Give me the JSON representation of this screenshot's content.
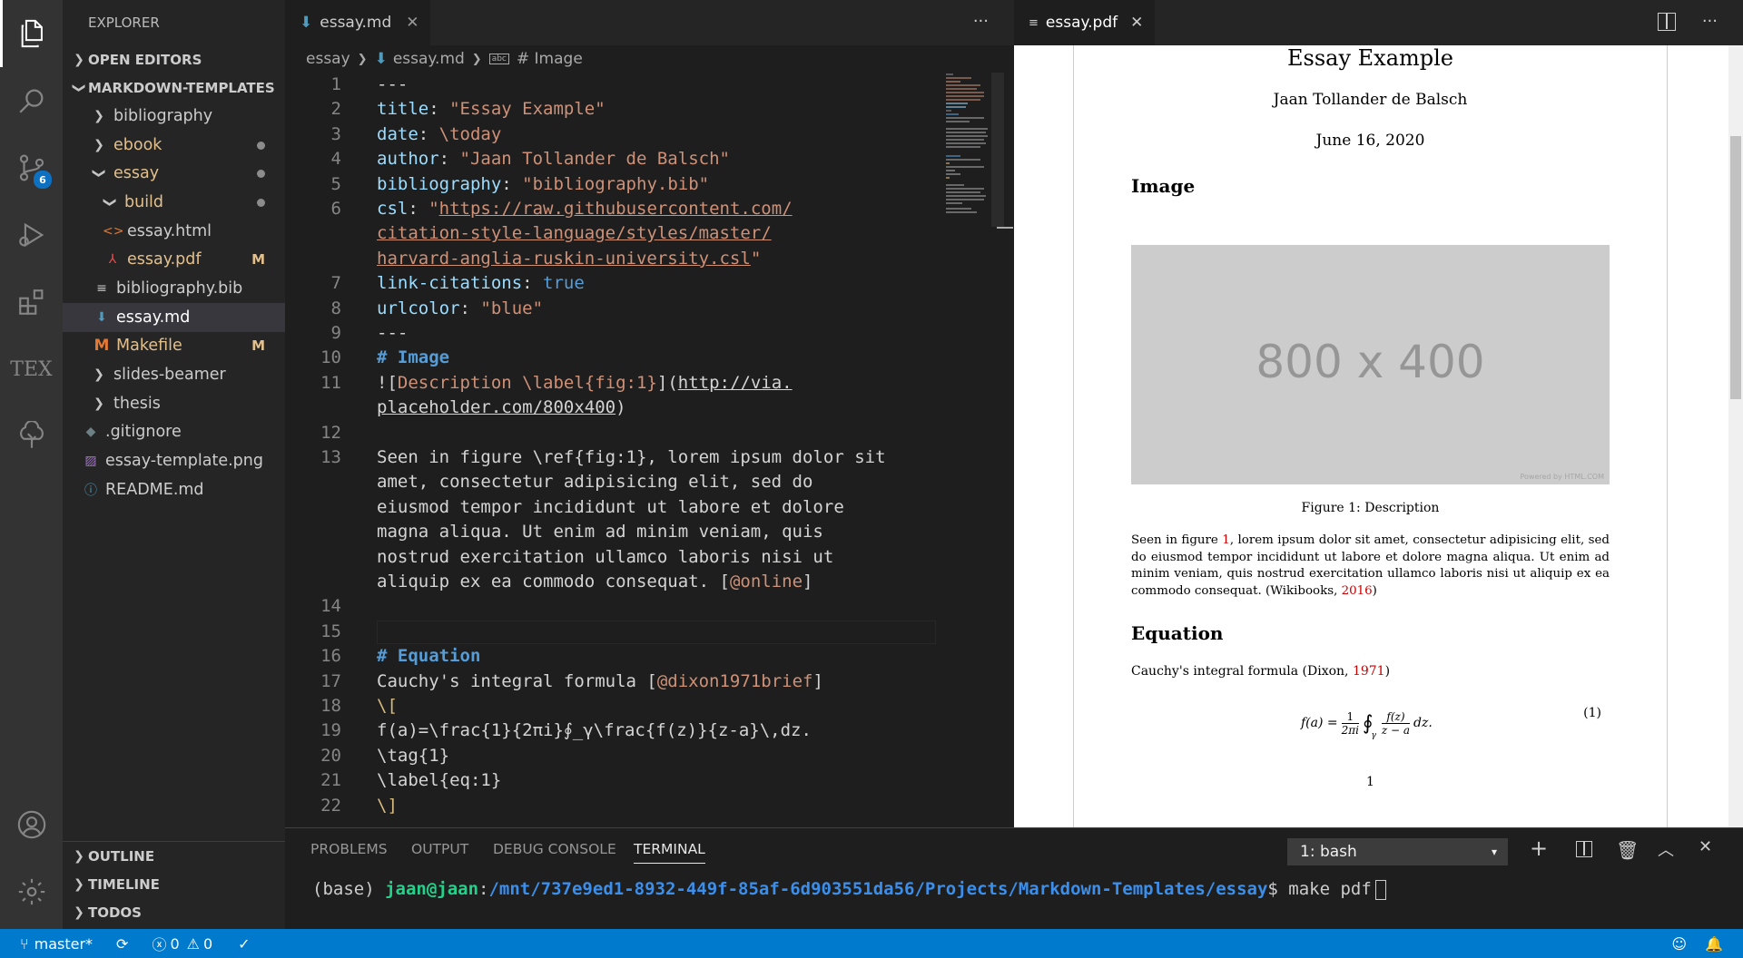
{
  "activity": {
    "scm_badge": "6",
    "tex_label": "TEX"
  },
  "sidebar": {
    "title": "EXPLORER",
    "open_editors": "OPEN EDITORS",
    "root": "MARKDOWN-TEMPLATES",
    "items": [
      {
        "label": "bibliography"
      },
      {
        "label": "ebook"
      },
      {
        "label": "essay"
      },
      {
        "label": "build"
      },
      {
        "label": "essay.html"
      },
      {
        "label": "essay.pdf",
        "status": "M"
      },
      {
        "label": "bibliography.bib"
      },
      {
        "label": "essay.md"
      },
      {
        "label": "Makefile",
        "status": "M"
      },
      {
        "label": "slides-beamer"
      },
      {
        "label": "thesis"
      },
      {
        "label": ".gitignore"
      },
      {
        "label": "essay-template.png"
      },
      {
        "label": "README.md"
      }
    ],
    "outline": "OUTLINE",
    "timeline": "TIMELINE",
    "todos": "TODOS"
  },
  "editor": {
    "tab_label": "essay.md",
    "more": "···",
    "breadcrumb": {
      "folder": "essay",
      "file": "essay.md",
      "symbol": "# Image"
    },
    "lines": [
      {
        "n": "1",
        "y": 0
      },
      {
        "n": "2",
        "y": 1
      },
      {
        "n": "3",
        "y": 2
      },
      {
        "n": "4",
        "y": 3
      },
      {
        "n": "5",
        "y": 4
      },
      {
        "n": "6",
        "y": 5
      },
      {
        "n": "7",
        "y": 8
      },
      {
        "n": "8",
        "y": 9
      },
      {
        "n": "9",
        "y": 10
      },
      {
        "n": "10",
        "y": 11
      },
      {
        "n": "11",
        "y": 12
      },
      {
        "n": "12",
        "y": 14
      },
      {
        "n": "13",
        "y": 15
      },
      {
        "n": "14",
        "y": 21
      },
      {
        "n": "15",
        "y": 22
      },
      {
        "n": "16",
        "y": 23
      },
      {
        "n": "17",
        "y": 24
      },
      {
        "n": "18",
        "y": 25
      },
      {
        "n": "19",
        "y": 26
      },
      {
        "n": "20",
        "y": 27
      },
      {
        "n": "21",
        "y": 28
      },
      {
        "n": "22",
        "y": 29
      }
    ],
    "code": {
      "l1": "---",
      "l2k": "title",
      "l2v": "\"Essay Example\"",
      "l3k": "date",
      "l3v": "\\today",
      "l4k": "author",
      "l4v": "\"Jaan Tollander de Balsch\"",
      "l5k": "bibliography",
      "l5v": "\"bibliography.bib\"",
      "l6k": "csl",
      "l6q": "\"",
      "l6a": "https://raw.githubusercontent.com/",
      "l6b": "citation-style-language/styles/master/",
      "l6c": "harvard-anglia-ruskin-university.csl",
      "l6e": "\"",
      "l7k": "link-citations",
      "l7v": "true",
      "l8k": "urlcolor",
      "l8v": "\"blue\"",
      "l9": "---",
      "l10": "# Image",
      "l11a": "![",
      "l11b": "Description \\label{fig:1}",
      "l11c": "](",
      "l11d": "http://via.",
      "l11e": "placeholder.com/800x400",
      "l11f": ")",
      "l13a": "Seen in figure \\ref{fig:1}, lorem ipsum dolor sit",
      "l13b": "amet, consectetur adipisicing elit, sed do",
      "l13c": "eiusmod tempor incididunt ut labore et dolore",
      "l13d": "magna aliqua. Ut enim ad minim veniam, quis",
      "l13e": "nostrud exercitation ullamco laboris nisi ut",
      "l13f": "aliquip ex ea commodo consequat. [",
      "l13g": "@online",
      "l13h": "]",
      "l16": "# Equation",
      "l17a": "Cauchy's integral formula [",
      "l17b": "@dixon1971brief",
      "l17c": "]",
      "l18": "\\[",
      "l19": "f(a)=\\frac{1}{2πi}∮_γ\\frac{f(z)}{z-a}\\,dz.",
      "l20": "\\tag{1}",
      "l21": "\\label{eq:1}",
      "l22": "\\]"
    }
  },
  "pdf": {
    "tab_label": "essay.pdf",
    "title": "Essay Example",
    "author": "Jaan Tollander de Balsch",
    "date": "June 16, 2020",
    "section1": "Image",
    "placeholder": "800 x 400",
    "powered": "Powered by HTML.COM",
    "caption": "Figure 1: Description",
    "para_a": "Seen in figure ",
    "para_ref": "1",
    "para_b": ", lorem ipsum dolor sit amet, consectetur adipisicing elit, sed do eiusmod tempor incididunt ut labore et dolore magna aliqua. Ut enim ad minim veniam, quis nostrud exercitation ullamco laboris nisi ut aliquip ex ea commodo consequat. (Wikibooks, ",
    "para_year": "2016",
    "para_c": ")",
    "section2": "Equation",
    "cauchy_a": "Cauchy's integral formula (Dixon, ",
    "cauchy_year": "1971",
    "cauchy_c": ")",
    "eq_lhs": "f(a) = ",
    "eq_frac_num": "1",
    "eq_frac_den": "2πi",
    "eq_int": "∮",
    "eq_sub": "γ",
    "eq_frac2_num": "f(z)",
    "eq_frac2_den": "z − a",
    "eq_tail": "dz.",
    "eq_tag": "(1)",
    "page_num": "1"
  },
  "panel": {
    "tabs": [
      "PROBLEMS",
      "OUTPUT",
      "DEBUG CONSOLE",
      "TERMINAL"
    ],
    "terminal_select": "1: bash",
    "prompt_env": "(base) ",
    "prompt_user": "jaan@jaan",
    "prompt_sep": ":",
    "prompt_path": "/mnt/737e9ed1-8932-449f-85af-6d903551da56/Projects/Markdown-Templates/essay",
    "prompt_cmd": "$ make pdf"
  },
  "status": {
    "branch": "master*",
    "errors": "0",
    "warnings": "0"
  }
}
